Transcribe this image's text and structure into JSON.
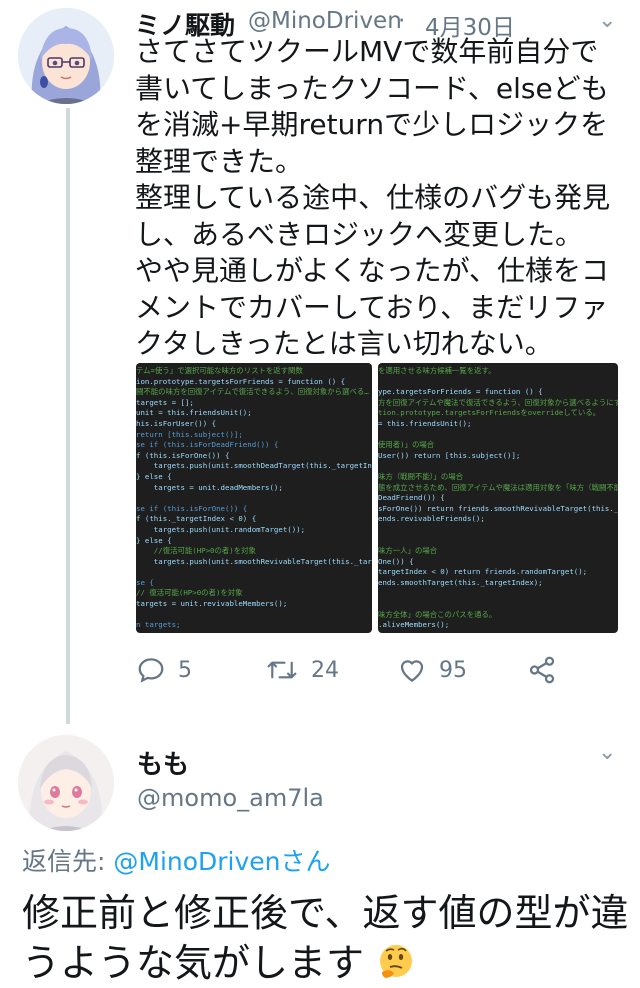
{
  "tweet": {
    "display_name": "ミノ駆動",
    "handle": "@MinoDriven",
    "separator": "·",
    "date": "4月30日",
    "text": "さてさてツクールMVで数年前自分で書いてしまったクソコード、elseどもを消滅+早期returnで少しロジックを整理できた。\n整理している途中、仕様のバグも発見し、あるべきロジックへ変更した。\nやや見通しがよくなったが、仕様をコメントでカバーしており、まだリファクタしきったとは言い切れない。",
    "code_left": [
      "テム=使う」で選択可能な味方のリストを返す関数",
      "ion.prototype.targetsForFriends = function () {",
      "闘不能の味方を回復アイテムで復活できるよう、回復対象から選べる…",
      "targets = [];",
      "unit = this.friendsUnit();",
      "his.isForUser()) {",
      "return [this.subject()];",
      "se if (this.isForDeadFriend()) {",
      "f (this.isForOne()) {",
      "    targets.push(unit.smoothDeadTarget(this._targetIndex));",
      "} else {",
      "    targets = unit.deadMembers();",
      "",
      "se if (this.isForOne()) {",
      "f (this._targetIndex < 0) {",
      "    targets.push(unit.randomTarget());",
      "} else {",
      "    //復活可能(HP>0の者)を対象",
      "    targets.push(unit.smoothRevivableTarget(this._targetIn",
      "",
      "se {",
      "// 復活可能(HP>0の者)を対象",
      "targets = unit.revivableMembers();",
      "",
      "n targets;"
    ],
    "code_right": [
      "を適用させる味方候補一覧を返す。",
      "",
      "ype.targetsForFriends = function () {",
      "方を回復アイテムや魔法で復活できるよう、回復対象から選べるようにする",
      "tion.prototype.targetsForFriendsをoverrideしている。",
      "= this.friendsUnit();",
      "",
      "使用者)」の場合",
      "User()) return [this.subject()];",
      "",
      "味方（戦闘不能）」の場合",
      "態を成立させるため、回復アイテムや魔法は適用対象を「味方（戦闘不能",
      "DeadFriend()) {",
      "sForOne()) return friends.smoothRevivableTarget(this._targetI",
      "ends.revivableFriends();",
      "",
      "",
      "味方一人」の場合",
      "One()) {",
      "targetIndex < 0) return friends.randomTarget();",
      "ends.smoothTarget(this._targetIndex);",
      "",
      "",
      "味方全体」の場合このパスを通る。",
      ".aliveMembers();"
    ],
    "actions": {
      "reply_icon": "reply-icon",
      "reply_count": "5",
      "retweet_icon": "retweet-icon",
      "retweet_count": "24",
      "like_icon": "heart-icon",
      "like_count": "95",
      "share_icon": "share-icon"
    }
  },
  "reply": {
    "display_name": "もも",
    "handle": "@momo_am7la",
    "reply_to_prefix": "返信先: ",
    "reply_to_user": "@MinoDrivenさん",
    "text": "修正前と修正後で、返す値の型が違うような気がします",
    "emoji": "thinking-face-emoji"
  },
  "colors": {
    "link": "#1da1f2",
    "muted": "#657786",
    "text": "#14171a",
    "thread_line": "#cfd9de",
    "code_bg": "#1e1e1e"
  }
}
